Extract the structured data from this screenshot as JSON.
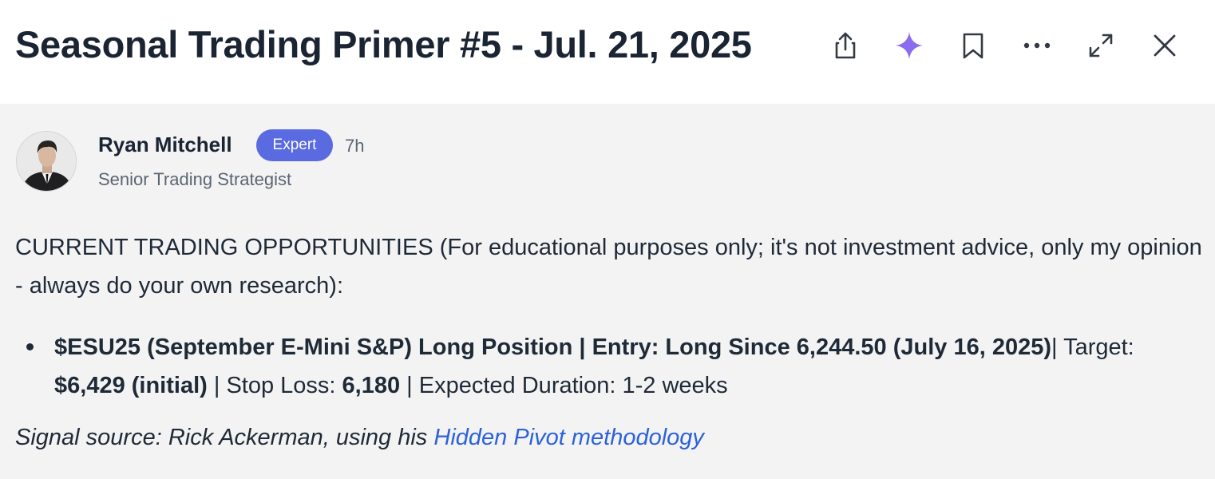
{
  "header": {
    "title": "Seasonal Trading Primer #5 - Jul. 21, 2025",
    "actions": {
      "share_icon": "share-icon",
      "ai_icon": "sparkle-icon",
      "bookmark_icon": "bookmark-icon",
      "more_icon": "more-icon",
      "expand_icon": "expand-icon",
      "close_icon": "close-icon"
    }
  },
  "author": {
    "name": "Ryan Mitchell",
    "badge": "Expert",
    "time_ago": "7h",
    "role": "Senior Trading Strategist"
  },
  "post": {
    "intro": "CURRENT TRADING OPPORTUNITIES (For educational purposes only; it's not investment advice, only my opinion - always do your own research):",
    "bullet": {
      "headline": "$ESU25 (September E-Mini S&P) Long Position | Entry: Long Since 6,244.50 (July 16, 2025)",
      "sep1": "| Target: ",
      "target_value": "$6,429 (initial)",
      "sep2": " | Stop Loss: ",
      "stop_value": "6,180",
      "sep3": " | Expected Duration: 1-2 weeks"
    },
    "signal_prefix": "Signal source: Rick Ackerman, using his ",
    "signal_link": "Hidden Pivot methodology"
  },
  "colors": {
    "badge_bg": "#5a6ae0",
    "link": "#2d62d8",
    "sparkle": "#8b6cf0"
  }
}
